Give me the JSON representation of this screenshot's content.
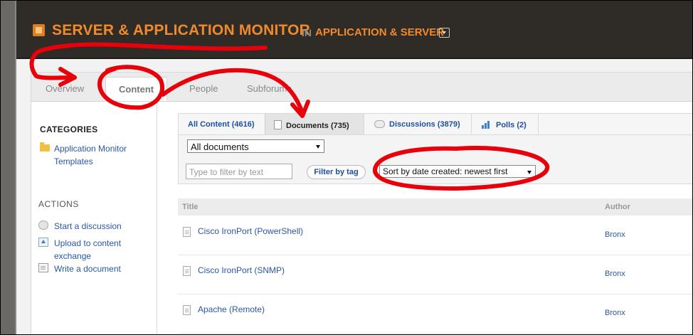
{
  "header": {
    "title": "SERVER & APPLICATION MONITOR",
    "in_label": "IN",
    "place": "APPLICATION & SERVER"
  },
  "tabs": [
    {
      "label": "Overview"
    },
    {
      "label": "Content"
    },
    {
      "label": "People"
    },
    {
      "label": "Subforums"
    }
  ],
  "sidebar": {
    "categories_title": "CATEGORIES",
    "category_link": "Application Monitor Templates",
    "actions_title": "ACTIONS",
    "actions": [
      {
        "label": "Start a discussion",
        "icon": "speech-bubble-icon"
      },
      {
        "label": "Upload to content exchange",
        "icon": "upload-icon"
      },
      {
        "label": "Write a document",
        "icon": "document-icon"
      }
    ]
  },
  "content_tabs": [
    {
      "label": "All Content (4616)"
    },
    {
      "label": "Documents (735)"
    },
    {
      "label": "Discussions (3879)"
    },
    {
      "label": "Polls (2)"
    }
  ],
  "filters": {
    "type_select": "All documents",
    "text_placeholder": "Type to filter by text",
    "tag_button": "Filter by tag",
    "sort_select": "Sort by date created: newest first"
  },
  "table": {
    "columns": [
      "Title",
      "Author"
    ],
    "rows": [
      {
        "title": "Cisco IronPort (PowerShell)",
        "author": "Bronx"
      },
      {
        "title": "Cisco IronPort (SNMP)",
        "author": "Bronx"
      },
      {
        "title": "Apache (Remote)",
        "author": "Bronx"
      }
    ]
  },
  "colors": {
    "header_bg": "#2f2b27",
    "brand_orange": "#f08a2a",
    "link_blue": "#2a56a8",
    "annotation_red": "#e8000a"
  }
}
